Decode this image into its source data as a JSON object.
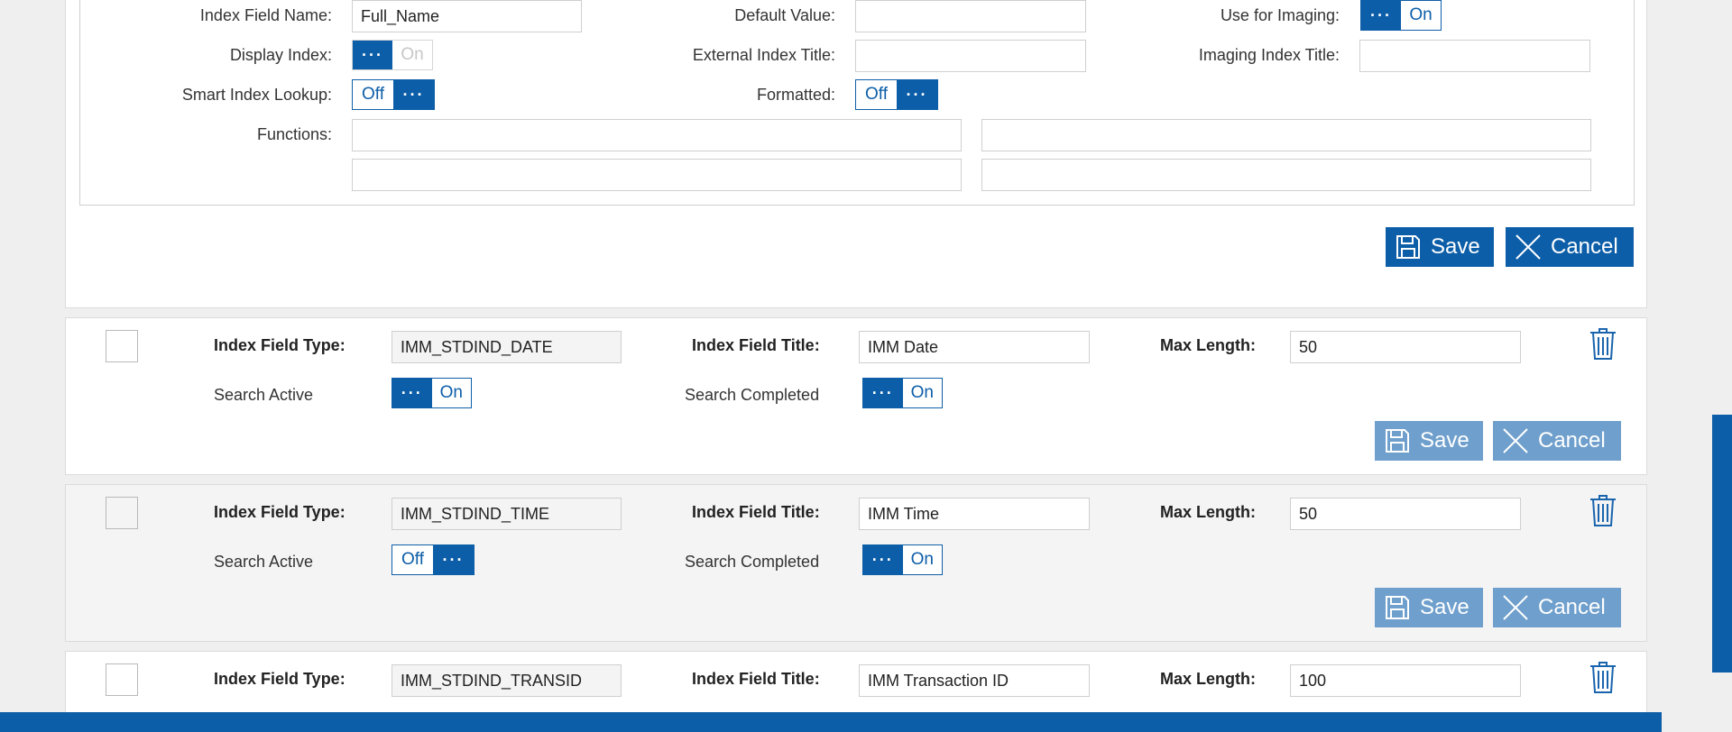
{
  "editor": {
    "index_field_name_label": "Index Field Name:",
    "index_field_name_value": "Full_Name",
    "default_value_label": "Default Value:",
    "default_value_value": "",
    "use_for_imaging_label": "Use for Imaging:",
    "use_for_imaging_toggle": {
      "dots": "···",
      "text": "On"
    },
    "display_index_label": "Display Index:",
    "display_index_toggle": {
      "dots": "···",
      "text": "On"
    },
    "external_index_title_label": "External Index Title:",
    "external_index_title_value": "",
    "imaging_index_title_label": "Imaging Index Title:",
    "imaging_index_title_value": "",
    "smart_index_lookup_label": "Smart Index Lookup:",
    "smart_index_lookup_toggle": {
      "dots": "···",
      "text": "Off"
    },
    "formatted_label": "Formatted:",
    "formatted_toggle": {
      "dots": "···",
      "text": "Off"
    },
    "functions_label": "Functions:",
    "functions_values": [
      "",
      "",
      "",
      ""
    ],
    "save_label": "Save",
    "cancel_label": "Cancel"
  },
  "rows": [
    {
      "type_label": "Index Field Type:",
      "type_value": "IMM_STDIND_DATE",
      "title_label": "Index Field Title:",
      "title_value": "IMM Date",
      "max_length_label": "Max Length:",
      "max_length_value": "50",
      "search_active_label": "Search Active",
      "search_active_toggle": {
        "dots": "···",
        "text": "On"
      },
      "search_completed_label": "Search Completed",
      "search_completed_toggle": {
        "dots": "···",
        "text": "On"
      },
      "save_label": "Save",
      "cancel_label": "Cancel"
    },
    {
      "type_label": "Index Field Type:",
      "type_value": "IMM_STDIND_TIME",
      "title_label": "Index Field Title:",
      "title_value": "IMM Time",
      "max_length_label": "Max Length:",
      "max_length_value": "50",
      "search_active_label": "Search Active",
      "search_active_toggle": {
        "dots": "···",
        "text": "Off"
      },
      "search_completed_label": "Search Completed",
      "search_completed_toggle": {
        "dots": "···",
        "text": "On"
      },
      "save_label": "Save",
      "cancel_label": "Cancel"
    },
    {
      "type_label": "Index Field Type:",
      "type_value": "IMM_STDIND_TRANSID",
      "title_label": "Index Field Title:",
      "title_value": "IMM Transaction ID",
      "max_length_label": "Max Length:",
      "max_length_value": "100"
    }
  ],
  "colors": {
    "accent": "#0d5ea8",
    "accent_faded": "#6f9fcc"
  }
}
